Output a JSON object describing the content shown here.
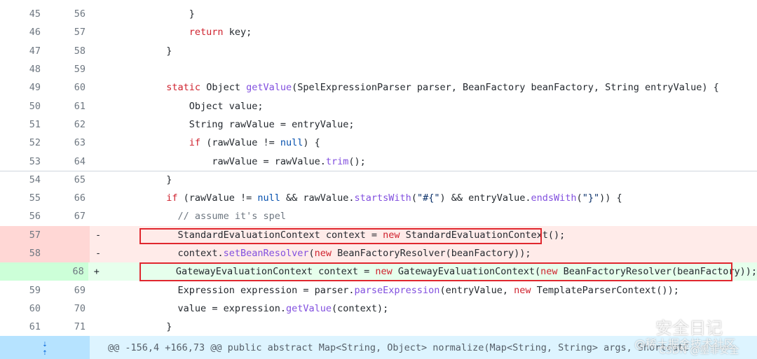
{
  "lines": [
    {
      "old": "45",
      "new": "56",
      "type": "ctx",
      "indent": "        ",
      "tokens": [
        [
          "",
          "}"
        ]
      ]
    },
    {
      "old": "46",
      "new": "57",
      "type": "ctx",
      "indent": "        ",
      "tokens": [
        [
          "kw",
          "return"
        ],
        [
          "",
          " key;"
        ]
      ]
    },
    {
      "old": "47",
      "new": "58",
      "type": "ctx",
      "indent": "    ",
      "tokens": [
        [
          "",
          "}"
        ]
      ]
    },
    {
      "old": "48",
      "new": "59",
      "type": "ctx",
      "indent": "",
      "tokens": []
    },
    {
      "old": "49",
      "new": "60",
      "type": "ctx",
      "indent": "    ",
      "tokens": [
        [
          "kw",
          "static"
        ],
        [
          "",
          " Object "
        ],
        [
          "fn",
          "getValue"
        ],
        [
          "",
          "(SpelExpressionParser parser, BeanFactory beanFactory, String entryValue) {"
        ]
      ]
    },
    {
      "old": "50",
      "new": "61",
      "type": "ctx",
      "indent": "        ",
      "tokens": [
        [
          "",
          "Object value;"
        ]
      ]
    },
    {
      "old": "51",
      "new": "62",
      "type": "ctx",
      "indent": "        ",
      "tokens": [
        [
          "",
          "String rawValue = entryValue;"
        ]
      ]
    },
    {
      "old": "52",
      "new": "63",
      "type": "ctx",
      "indent": "        ",
      "tokens": [
        [
          "kw",
          "if"
        ],
        [
          "",
          " (rawValue != "
        ],
        [
          "nul",
          "null"
        ],
        [
          "",
          ") {"
        ]
      ]
    },
    {
      "old": "53",
      "new": "64",
      "type": "ctx",
      "indent": "            ",
      "tokens": [
        [
          "",
          "rawValue = rawValue."
        ],
        [
          "fn",
          "trim"
        ],
        [
          "",
          "();"
        ]
      ]
    },
    {
      "old": "54",
      "new": "65",
      "type": "ctx",
      "indent": "    ",
      "tokens": [
        [
          "",
          "}"
        ]
      ]
    },
    {
      "old": "55",
      "new": "66",
      "type": "ctx",
      "indent": "    ",
      "tokens": [
        [
          "kw",
          "if"
        ],
        [
          "",
          " (rawValue != "
        ],
        [
          "nul",
          "null"
        ],
        [
          "",
          " && rawValue."
        ],
        [
          "fn",
          "startsWith"
        ],
        [
          "",
          "("
        ],
        [
          "str",
          "\"#{\""
        ],
        [
          "",
          ") && entryValue."
        ],
        [
          "fn",
          "endsWith"
        ],
        [
          "",
          "("
        ],
        [
          "str",
          "\"}\""
        ],
        [
          "",
          ")) {"
        ]
      ]
    },
    {
      "old": "56",
      "new": "67",
      "type": "ctx",
      "indent": "      ",
      "tokens": [
        [
          "cm",
          "// assume it's spel"
        ]
      ]
    },
    {
      "old": "57",
      "new": "",
      "type": "del",
      "sign": "-",
      "indent": "      ",
      "tokens": [
        [
          "",
          "StandardEvaluationContext context = "
        ],
        [
          "kw",
          "new"
        ],
        [
          "",
          " StandardEvaluationContext();"
        ]
      ]
    },
    {
      "old": "58",
      "new": "",
      "type": "del",
      "sign": "-",
      "indent": "      ",
      "tokens": [
        [
          "",
          "context."
        ],
        [
          "fn",
          "setBeanResolver"
        ],
        [
          "",
          "("
        ],
        [
          "kw",
          "new"
        ],
        [
          "",
          " BeanFactoryResolver(beanFactory));"
        ]
      ]
    },
    {
      "old": "",
      "new": "68",
      "type": "add",
      "sign": "+",
      "indent": "      ",
      "tokens": [
        [
          "",
          "GatewayEvaluationContext context = "
        ],
        [
          "kw",
          "new"
        ],
        [
          "",
          " GatewayEvaluationContext("
        ],
        [
          "kw",
          "new"
        ],
        [
          "",
          " BeanFactoryResolver(beanFactory));"
        ]
      ]
    },
    {
      "old": "59",
      "new": "69",
      "type": "ctx",
      "indent": "      ",
      "tokens": [
        [
          "",
          "Expression expression = parser."
        ],
        [
          "fn",
          "parseExpression"
        ],
        [
          "",
          "(entryValue, "
        ],
        [
          "kw",
          "new"
        ],
        [
          "",
          " TemplateParserContext());"
        ]
      ]
    },
    {
      "old": "60",
      "new": "70",
      "type": "ctx",
      "indent": "      ",
      "tokens": [
        [
          "",
          "value = expression."
        ],
        [
          "fn",
          "getValue"
        ],
        [
          "",
          "(context);"
        ]
      ]
    },
    {
      "old": "61",
      "new": "71",
      "type": "ctx",
      "indent": "    ",
      "tokens": [
        [
          "",
          "}"
        ]
      ]
    }
  ],
  "hunk": {
    "header": "@@ -156,4 +166,73 @@ public abstract Map<String, Object> normalize(Map<String, String> args, ShortcutC",
    "expand_down_icon": "arrow-down-icon",
    "expand_up_icon": "arrow-up-icon"
  },
  "watermark": {
    "name": "安全日记",
    "sub": "@稀土掘金技术社区",
    "csdn": "CSDN @墨菲安全"
  },
  "colors": {
    "deleted_bg": "#ffebe9",
    "added_bg": "#e6ffec",
    "highlight_box": "#e0272e"
  }
}
